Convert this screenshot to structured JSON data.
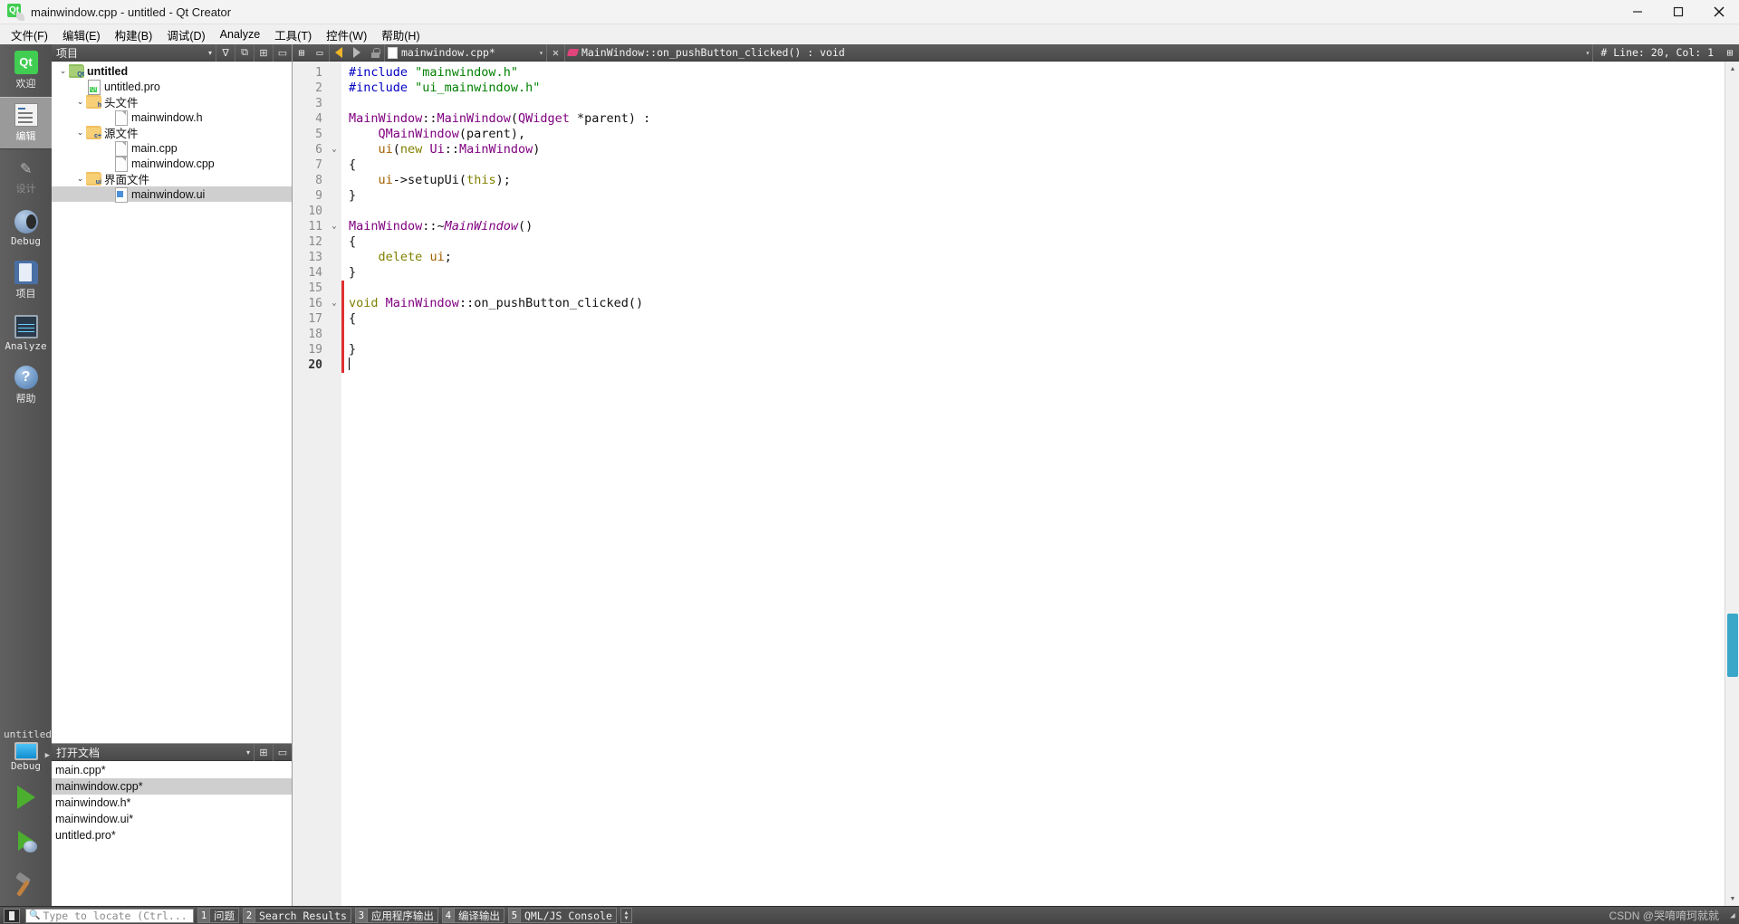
{
  "window": {
    "title": "mainwindow.cpp - untitled - Qt Creator",
    "logo_text": "Qt",
    "minimize": "─",
    "maximize": "❐",
    "close": "✕"
  },
  "menubar": [
    {
      "label": "文件(F)"
    },
    {
      "label": "编辑(E)"
    },
    {
      "label": "构建(B)"
    },
    {
      "label": "调试(D)"
    },
    {
      "label": "Analyze"
    },
    {
      "label": "工具(T)"
    },
    {
      "label": "控件(W)"
    },
    {
      "label": "帮助(H)"
    }
  ],
  "modebar": {
    "items": [
      {
        "label": "欢迎",
        "icon": "qt-welcome-icon",
        "state": "normal"
      },
      {
        "label": "编辑",
        "icon": "edit-document-icon",
        "state": "selected"
      },
      {
        "label": "设计",
        "icon": "design-tools-icon",
        "state": "disabled"
      },
      {
        "label": "Debug",
        "icon": "debug-bug-icon",
        "state": "normal"
      },
      {
        "label": "项目",
        "icon": "projects-folder-icon",
        "state": "normal"
      },
      {
        "label": "Analyze",
        "icon": "analyze-monitor-icon",
        "state": "normal"
      },
      {
        "label": "帮助",
        "icon": "help-question-icon",
        "state": "normal"
      }
    ],
    "kit_name": "untitled",
    "kit_config": "Debug",
    "run_icon": "run-play-icon",
    "debug_icon": "run-debug-icon",
    "build_icon": "build-hammer-icon"
  },
  "project_panel": {
    "title": "项目",
    "combo_arrow": "▾",
    "buttons": [
      {
        "name": "filter-icon",
        "glyph": "∇"
      },
      {
        "name": "link-editor-icon",
        "glyph": "⧉"
      },
      {
        "name": "split-icon",
        "glyph": "⊞"
      },
      {
        "name": "close-panel-icon",
        "glyph": "▭"
      }
    ],
    "tree": [
      {
        "label": "untitled",
        "indent": 0,
        "chevron": "⌄",
        "icon": "qt-project-folder-icon",
        "bold": true,
        "selected": false
      },
      {
        "label": "untitled.pro",
        "indent": 1,
        "chevron": "",
        "icon": "qt-pro-file-icon",
        "bold": false,
        "selected": false
      },
      {
        "label": "头文件",
        "indent": 1,
        "chevron": "⌄",
        "icon": "header-folder-icon",
        "tag": "h",
        "bold": false,
        "selected": false
      },
      {
        "label": "mainwindow.h",
        "indent": 2,
        "chevron": "",
        "icon": "file-icon",
        "bold": false,
        "selected": false
      },
      {
        "label": "源文件",
        "indent": 1,
        "chevron": "⌄",
        "icon": "source-folder-icon",
        "tag": "c+",
        "bold": false,
        "selected": false
      },
      {
        "label": "main.cpp",
        "indent": 2,
        "chevron": "",
        "icon": "file-icon",
        "bold": false,
        "selected": false
      },
      {
        "label": "mainwindow.cpp",
        "indent": 2,
        "chevron": "",
        "icon": "file-icon",
        "bold": false,
        "selected": false
      },
      {
        "label": "界面文件",
        "indent": 1,
        "chevron": "⌄",
        "icon": "forms-folder-icon",
        "tag": "ui",
        "bold": false,
        "selected": false
      },
      {
        "label": "mainwindow.ui",
        "indent": 2,
        "chevron": "",
        "icon": "ui-file-icon",
        "bold": false,
        "selected": true
      }
    ]
  },
  "open_documents": {
    "title": "打开文档",
    "combo_arrow": "▾",
    "buttons": [
      {
        "name": "split-icon",
        "glyph": "⊞"
      },
      {
        "name": "close-panel-icon",
        "glyph": "▭"
      }
    ],
    "items": [
      {
        "label": "main.cpp*",
        "selected": false
      },
      {
        "label": "mainwindow.cpp*",
        "selected": true
      },
      {
        "label": "mainwindow.h*",
        "selected": false
      },
      {
        "label": "mainwindow.ui*",
        "selected": false
      },
      {
        "label": "untitled.pro*",
        "selected": false
      }
    ]
  },
  "editor_toolbar": {
    "left_buttons": [
      {
        "name": "split-icon",
        "glyph": "⊞"
      },
      {
        "name": "close-split-icon",
        "glyph": "▭"
      }
    ],
    "back_tooltip": "back-arrow-icon",
    "forward_tooltip": "forward-arrow-icon",
    "lock_icon": "unlocked-icon",
    "file_combo": "mainwindow.cpp*",
    "file_combo_arrow": "▾",
    "close_glyph": "✕",
    "symbol_combo": "MainWindow::on_pushButton_clicked() : void",
    "symbol_combo_arrow": "▾",
    "line_label": "#  Line: 20, Col: 1",
    "right_button": "⊞"
  },
  "code": {
    "total_lines": 20,
    "fold_lines": [
      6,
      11,
      16
    ],
    "changed_lines": [
      15,
      16,
      17,
      18,
      19,
      20
    ],
    "caret_line": 20,
    "lines": [
      {
        "n": 1,
        "tokens": [
          {
            "t": "#include ",
            "c": "tk-pre"
          },
          {
            "t": "\"mainwindow.h\"",
            "c": "tk-str"
          }
        ]
      },
      {
        "n": 2,
        "tokens": [
          {
            "t": "#include ",
            "c": "tk-pre"
          },
          {
            "t": "\"ui_mainwindow.h\"",
            "c": "tk-str"
          }
        ]
      },
      {
        "n": 3,
        "tokens": []
      },
      {
        "n": 4,
        "tokens": [
          {
            "t": "MainWindow",
            "c": "tk-type"
          },
          {
            "t": "::",
            "c": ""
          },
          {
            "t": "MainWindow",
            "c": "tk-type"
          },
          {
            "t": "(",
            "c": ""
          },
          {
            "t": "QWidget",
            "c": "tk-type"
          },
          {
            "t": " *parent) :",
            "c": ""
          }
        ]
      },
      {
        "n": 5,
        "tokens": [
          {
            "t": "    ",
            "c": ""
          },
          {
            "t": "QMainWindow",
            "c": "tk-type"
          },
          {
            "t": "(parent),",
            "c": ""
          }
        ]
      },
      {
        "n": 6,
        "tokens": [
          {
            "t": "    ",
            "c": ""
          },
          {
            "t": "ui",
            "c": "tk-var"
          },
          {
            "t": "(",
            "c": ""
          },
          {
            "t": "new",
            "c": "tk-kw"
          },
          {
            "t": " ",
            "c": ""
          },
          {
            "t": "Ui",
            "c": "tk-type"
          },
          {
            "t": "::",
            "c": ""
          },
          {
            "t": "MainWindow",
            "c": "tk-type"
          },
          {
            "t": ")",
            "c": ""
          }
        ]
      },
      {
        "n": 7,
        "tokens": [
          {
            "t": "{",
            "c": ""
          }
        ]
      },
      {
        "n": 8,
        "tokens": [
          {
            "t": "    ",
            "c": ""
          },
          {
            "t": "ui",
            "c": "tk-var"
          },
          {
            "t": "->setupUi(",
            "c": ""
          },
          {
            "t": "this",
            "c": "tk-kw"
          },
          {
            "t": ");",
            "c": ""
          }
        ]
      },
      {
        "n": 9,
        "tokens": [
          {
            "t": "}",
            "c": ""
          }
        ]
      },
      {
        "n": 10,
        "tokens": []
      },
      {
        "n": 11,
        "tokens": [
          {
            "t": "MainWindow",
            "c": "tk-type"
          },
          {
            "t": "::~",
            "c": ""
          },
          {
            "t": "MainWindow",
            "c": "tk-dtor"
          },
          {
            "t": "()",
            "c": ""
          }
        ]
      },
      {
        "n": 12,
        "tokens": [
          {
            "t": "{",
            "c": ""
          }
        ]
      },
      {
        "n": 13,
        "tokens": [
          {
            "t": "    ",
            "c": ""
          },
          {
            "t": "delete",
            "c": "tk-kw"
          },
          {
            "t": " ",
            "c": ""
          },
          {
            "t": "ui",
            "c": "tk-var"
          },
          {
            "t": ";",
            "c": ""
          }
        ]
      },
      {
        "n": 14,
        "tokens": [
          {
            "t": "}",
            "c": ""
          }
        ]
      },
      {
        "n": 15,
        "tokens": []
      },
      {
        "n": 16,
        "tokens": [
          {
            "t": "void",
            "c": "tk-kw"
          },
          {
            "t": " ",
            "c": ""
          },
          {
            "t": "MainWindow",
            "c": "tk-type"
          },
          {
            "t": "::on_pushButton_clicked()",
            "c": ""
          }
        ]
      },
      {
        "n": 17,
        "tokens": [
          {
            "t": "{",
            "c": ""
          }
        ]
      },
      {
        "n": 18,
        "tokens": []
      },
      {
        "n": 19,
        "tokens": [
          {
            "t": "}",
            "c": ""
          }
        ]
      },
      {
        "n": 20,
        "tokens": []
      }
    ]
  },
  "statusbar": {
    "toggle_sidebar_icon": "toggle-sidebar-icon",
    "locator_placeholder": "Type to locate (Ctrl...",
    "locator_icon": "search-icon",
    "panes": [
      {
        "num": "1",
        "label": "问题"
      },
      {
        "num": "2",
        "label": "Search Results"
      },
      {
        "num": "3",
        "label": "应用程序输出"
      },
      {
        "num": "4",
        "label": "编译输出"
      },
      {
        "num": "5",
        "label": "QML/JS Console"
      }
    ],
    "stepper_up": "▲",
    "stepper_down": "▼",
    "watermark": "CSDN @哭唷唷珂就就"
  },
  "colors": {
    "accent_green": "#41cd52",
    "selection_gray": "#cfcfcf",
    "change_marker": "#e03030",
    "scrollbar_thumb": "#3ba7c8"
  }
}
